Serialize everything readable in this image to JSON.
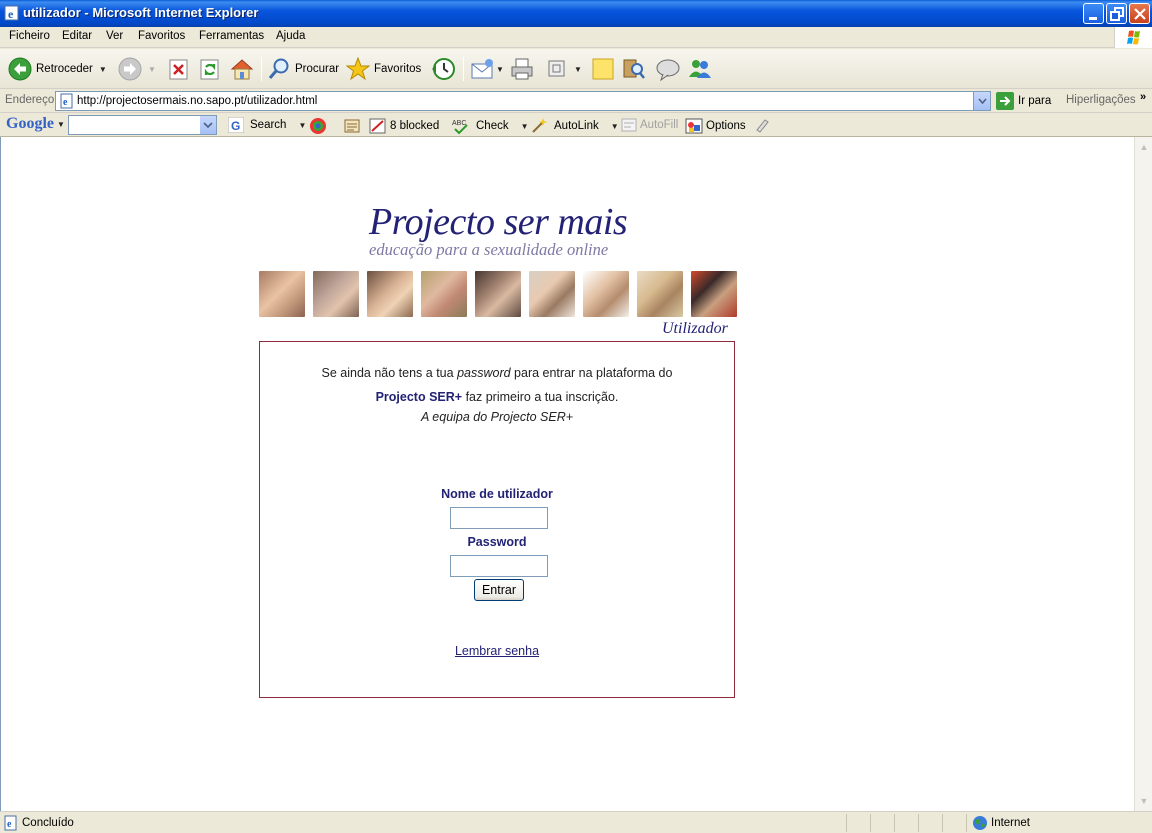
{
  "window": {
    "title": "utilizador - Microsoft Internet Explorer",
    "buttons": [
      "minimize",
      "restore",
      "close"
    ]
  },
  "menu": [
    "Ficheiro",
    "Editar",
    "Ver",
    "Favoritos",
    "Ferramentas",
    "Ajuda"
  ],
  "toolbar": {
    "back_label": "Retroceder",
    "search_label": "Procurar",
    "favorites_label": "Favoritos"
  },
  "address": {
    "label": "Endereço",
    "url": "http://projectosermais.no.sapo.pt/utilizador.html",
    "go_label": "Ir para",
    "links_label": "Hiperligações"
  },
  "google_bar": {
    "logo": "Google",
    "search_label": "Search",
    "blocked_label": "8 blocked",
    "check_label": "Check",
    "autolink_label": "AutoLink",
    "autofill_label": "AutoFill",
    "options_label": "Options"
  },
  "page": {
    "brand_title": "Projecto ser mais",
    "tagline": "educação para a sexualidade online",
    "section": "Utilizador",
    "intro_line1_a": "Se ainda não tens a tua ",
    "intro_line1_em": "password",
    "intro_line1_b": " para entrar na plataforma do",
    "intro_line2_strong": "Projecto SER+",
    "intro_line2_rest": " faz primeiro a tua inscrição.",
    "signature": "A equipa do Projecto SER+",
    "username_label": "Nome de utilizador",
    "username_value": "",
    "password_label": "Password",
    "password_value": "",
    "submit_label": "Entrar",
    "forgot_label": "Lembrar senha"
  },
  "status": {
    "text": "Concluído",
    "zone": "Internet"
  },
  "colors": {
    "brand": "#232275",
    "tagline": "#7d78a4",
    "box_border": "#8e2a3c",
    "title_bar": "#0855dd"
  }
}
